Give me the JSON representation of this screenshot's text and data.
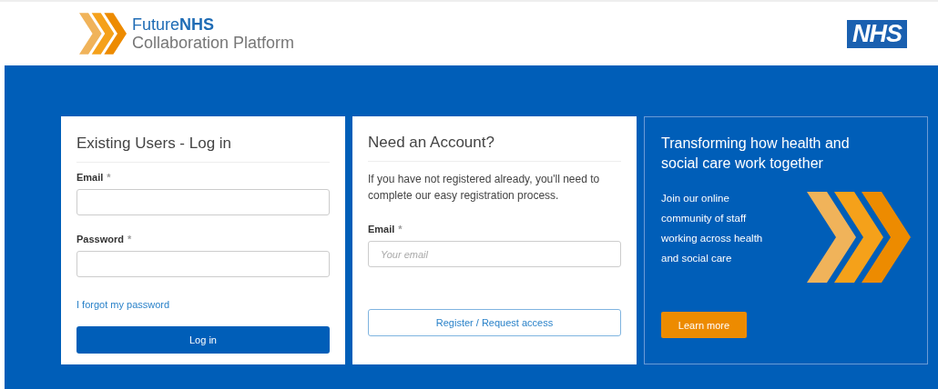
{
  "header": {
    "logo_title": "Future**NHS**",
    "logo_subtitle": "Collaboration Platform",
    "brand_badge": "NHS"
  },
  "login": {
    "title": "Existing Users - Log in",
    "fields": [
      {
        "label": "Email",
        "required_mark": "*"
      },
      {
        "label": "Password",
        "required_mark": "*"
      }
    ],
    "forgot_link": "I forgot my password",
    "submit": "Log in"
  },
  "register": {
    "title": "Need an Account?",
    "intro": "If you have not registered already, you'll need to complete our easy registration process.",
    "fields": [
      {
        "label": "Email",
        "required_mark": "*",
        "placeholder": "Your email"
      }
    ],
    "submit": "Register / Request access"
  },
  "promo": {
    "title": "Transforming how health and social care work together",
    "body": "Join our online community of staff working across health and social care",
    "button": "Learn more"
  }
}
